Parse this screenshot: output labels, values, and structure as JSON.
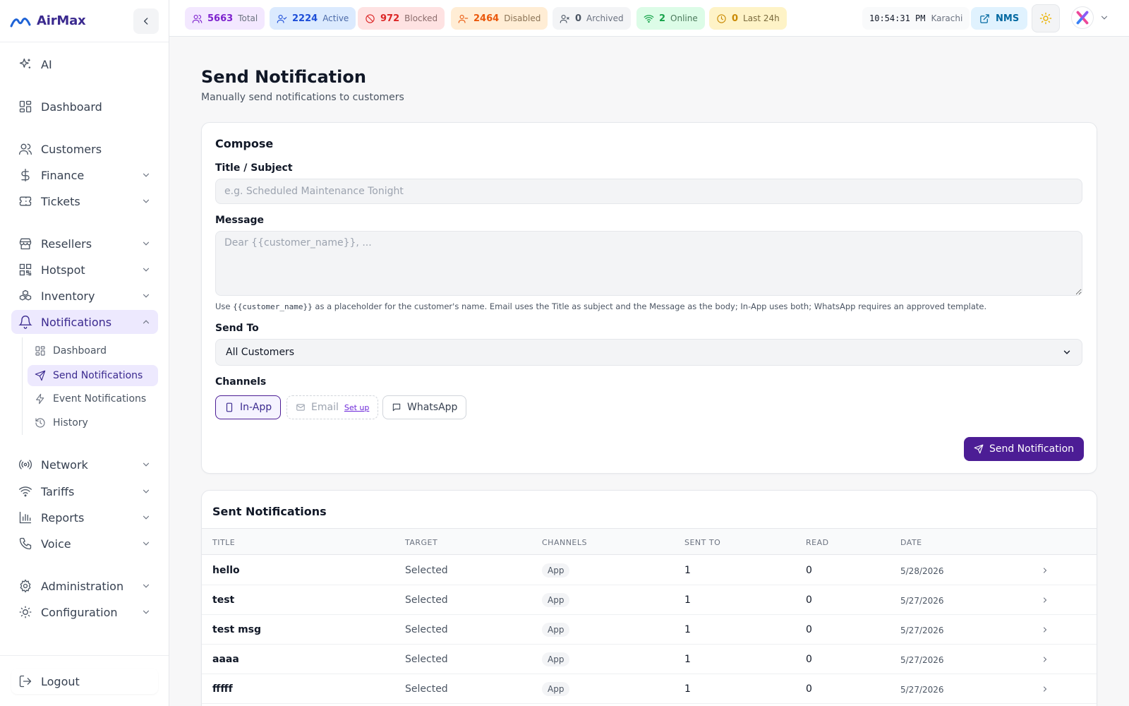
{
  "brand": {
    "name": "AirMax"
  },
  "sidebar": {
    "items": [
      {
        "label": "AI",
        "icon": "sparkles-icon"
      },
      {
        "label": "Dashboard",
        "icon": "dashboard-icon"
      },
      {
        "label": "Customers",
        "icon": "users-icon"
      },
      {
        "label": "Finance",
        "icon": "dollar-icon"
      },
      {
        "label": "Tickets",
        "icon": "ticket-icon"
      },
      {
        "label": "Resellers",
        "icon": "store-icon"
      },
      {
        "label": "Hotspot",
        "icon": "qr-icon"
      },
      {
        "label": "Inventory",
        "icon": "boxes-icon"
      },
      {
        "label": "Notifications",
        "icon": "bell-icon"
      },
      {
        "label": "Network",
        "icon": "radio-icon"
      },
      {
        "label": "Tariffs",
        "icon": "wifi-icon"
      },
      {
        "label": "Reports",
        "icon": "bar-chart-icon"
      },
      {
        "label": "Voice",
        "icon": "phone-icon"
      },
      {
        "label": "Administration",
        "icon": "gear-icon"
      },
      {
        "label": "Configuration",
        "icon": "cog-icon"
      }
    ],
    "notifications_sub": [
      {
        "label": "Dashboard"
      },
      {
        "label": "Send Notifications"
      },
      {
        "label": "Event Notifications"
      },
      {
        "label": "History"
      }
    ],
    "logout": "Logout"
  },
  "topbar": {
    "stats": {
      "total": {
        "value": "5663",
        "label": "Total"
      },
      "active": {
        "value": "2224",
        "label": "Active"
      },
      "blocked": {
        "value": "972",
        "label": "Blocked"
      },
      "disabled": {
        "value": "2464",
        "label": "Disabled"
      },
      "archived": {
        "value": "0",
        "label": "Archived"
      },
      "online": {
        "value": "2",
        "label": "Online"
      },
      "last24": {
        "value": "0",
        "label": "Last 24h"
      }
    },
    "clock": {
      "time": "10:54:31 PM",
      "tz": "Karachi"
    },
    "nms_label": "NMS"
  },
  "page": {
    "title": "Send Notification",
    "subtitle": "Manually send notifications to customers"
  },
  "compose": {
    "heading": "Compose",
    "title_label": "Title / Subject",
    "title_placeholder": "e.g. Scheduled Maintenance Tonight",
    "title_value": "",
    "message_label": "Message",
    "message_placeholder": "Dear {{customer_name}}, ...",
    "message_value": "",
    "hint_before": "Use",
    "hint_code": "{{customer_name}}",
    "hint_after": "as a placeholder for the customer's name. Email uses the Title as subject and the Message as the body; In-App uses both; WhatsApp requires an approved template.",
    "send_to_label": "Send To",
    "send_to_value": "All Customers",
    "channels_label": "Channels",
    "channels": {
      "inapp": "In-App",
      "email": "Email",
      "email_setup": "Set up",
      "whatsapp": "WhatsApp"
    },
    "send_button": "Send Notification"
  },
  "sent": {
    "heading": "Sent Notifications",
    "columns": [
      "TITLE",
      "TARGET",
      "CHANNELS",
      "SENT TO",
      "READ",
      "DATE"
    ],
    "rows": [
      {
        "title": "hello",
        "target": "Selected",
        "channel": "App",
        "sent_to": "1",
        "read": "0",
        "date": "5/28/2026"
      },
      {
        "title": "test",
        "target": "Selected",
        "channel": "App",
        "sent_to": "1",
        "read": "0",
        "date": "5/27/2026"
      },
      {
        "title": "test msg",
        "target": "Selected",
        "channel": "App",
        "sent_to": "1",
        "read": "0",
        "date": "5/27/2026"
      },
      {
        "title": "aaaa",
        "target": "Selected",
        "channel": "App",
        "sent_to": "1",
        "read": "0",
        "date": "5/27/2026"
      },
      {
        "title": "fffff",
        "target": "Selected",
        "channel": "App",
        "sent_to": "1",
        "read": "0",
        "date": "5/27/2026"
      }
    ]
  },
  "colors": {
    "brand": "#3b2a8f",
    "primary_button": "#4c1d95",
    "active_nav_bg": "#ede9fe"
  }
}
